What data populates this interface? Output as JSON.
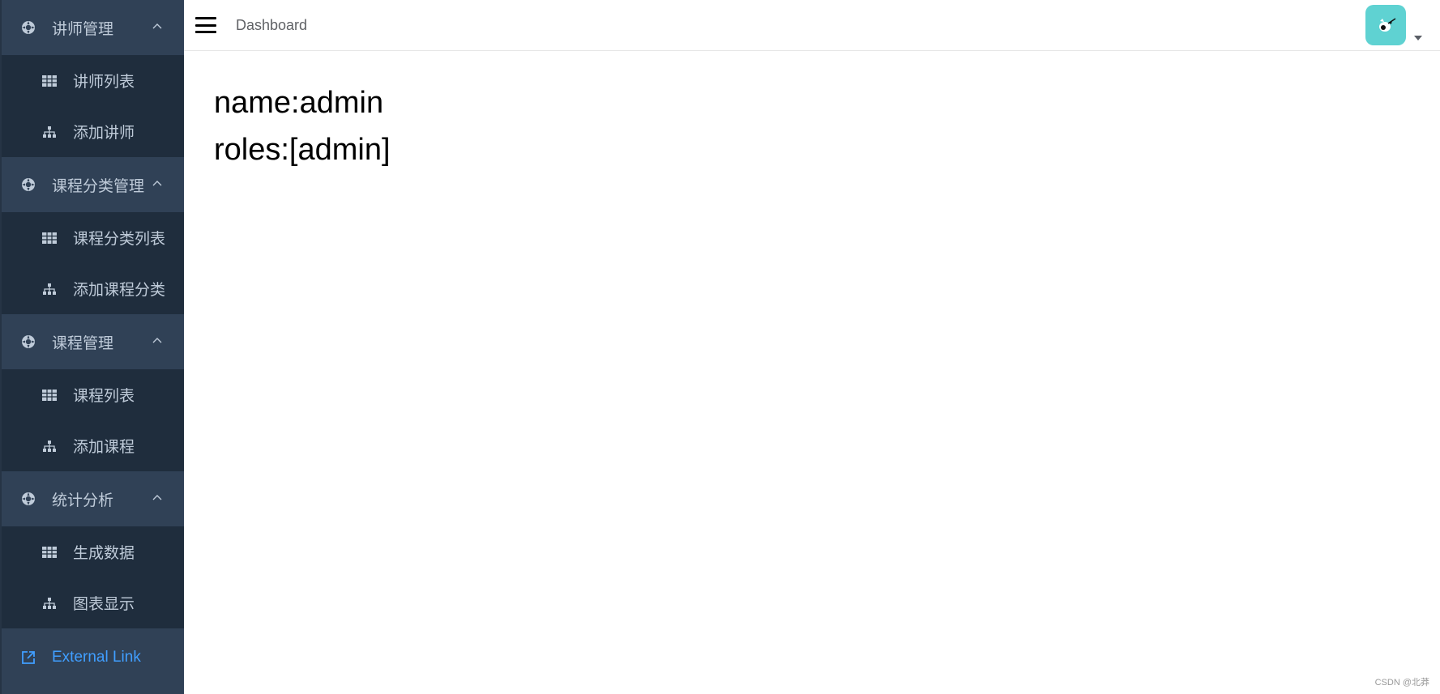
{
  "sidebar": {
    "groups": [
      {
        "title": "讲师管理",
        "items": [
          {
            "label": "讲师列表",
            "icon": "table-icon"
          },
          {
            "label": "添加讲师",
            "icon": "tree-icon"
          }
        ]
      },
      {
        "title": "课程分类管理",
        "items": [
          {
            "label": "课程分类列表",
            "icon": "table-icon"
          },
          {
            "label": "添加课程分类",
            "icon": "tree-icon"
          }
        ]
      },
      {
        "title": "课程管理",
        "items": [
          {
            "label": "课程列表",
            "icon": "table-icon"
          },
          {
            "label": "添加课程",
            "icon": "tree-icon"
          }
        ]
      },
      {
        "title": "统计分析",
        "items": [
          {
            "label": "生成数据",
            "icon": "table-icon"
          },
          {
            "label": "图表显示",
            "icon": "tree-icon"
          }
        ]
      }
    ],
    "external_link": "External Link"
  },
  "navbar": {
    "breadcrumb": "Dashboard"
  },
  "main": {
    "name_line": "name:admin",
    "roles_line": "roles:[admin]"
  },
  "watermark": "CSDN @北莽",
  "colors": {
    "sidebar_bg": "#304156",
    "submenu_bg": "#1f2d3d",
    "menu_text": "#bfcbd9",
    "link_accent": "#409eff",
    "avatar_bg": "#5fd2d2"
  }
}
